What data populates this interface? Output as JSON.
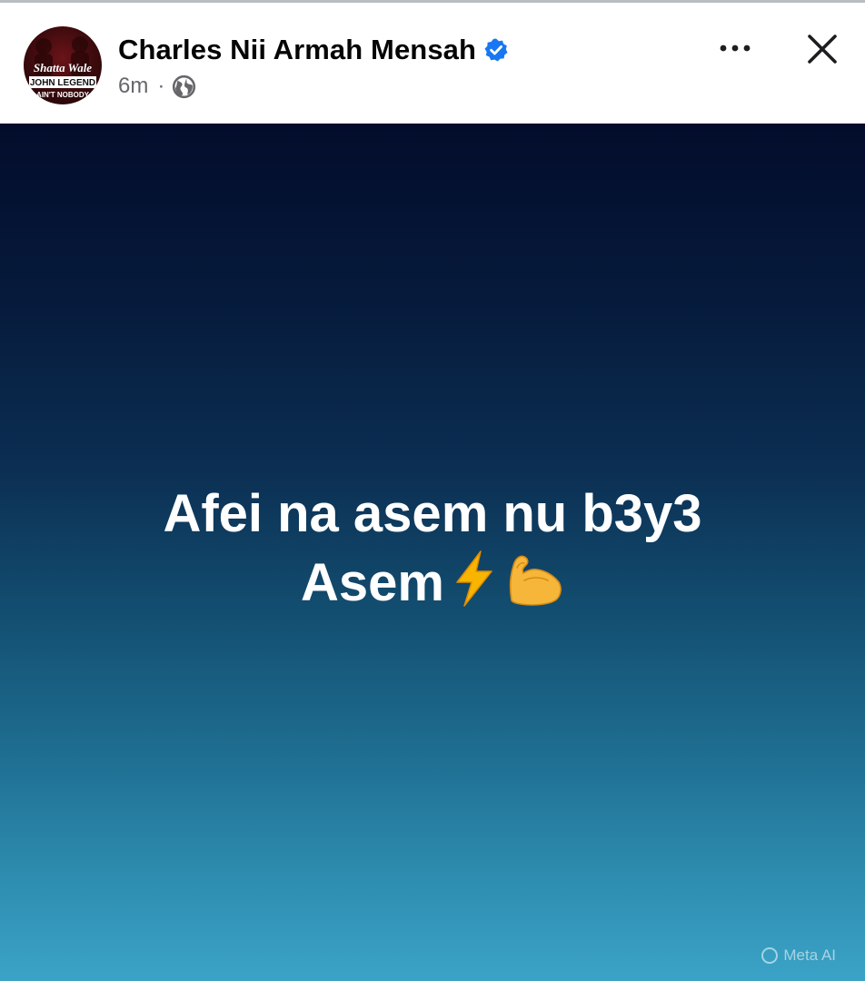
{
  "post": {
    "author_name": "Charles Nii Armah Mensah",
    "verified": true,
    "time_ago": "6m",
    "separator": "·",
    "privacy_icon": "globe-icon",
    "line1": "Afei na asem nu b3y3",
    "line2": "Asem",
    "emojis": [
      "lightning-emoji",
      "flexed-biceps-emoji"
    ]
  },
  "avatar": {
    "text_line1": "Shatta Wale",
    "text_line2": "JOHN LEGEND",
    "text_line3": "AIN'T NOBODY"
  },
  "header_actions": {
    "more_icon": "more-options-icon",
    "close_icon": "close-icon"
  },
  "watermark": {
    "label": "Meta AI"
  },
  "colors": {
    "verified_blue": "#1877f2",
    "secondary_text": "#65676b",
    "primary_text": "#050505",
    "background_top": "#030c2b",
    "background_bottom": "#3ba3c7"
  }
}
